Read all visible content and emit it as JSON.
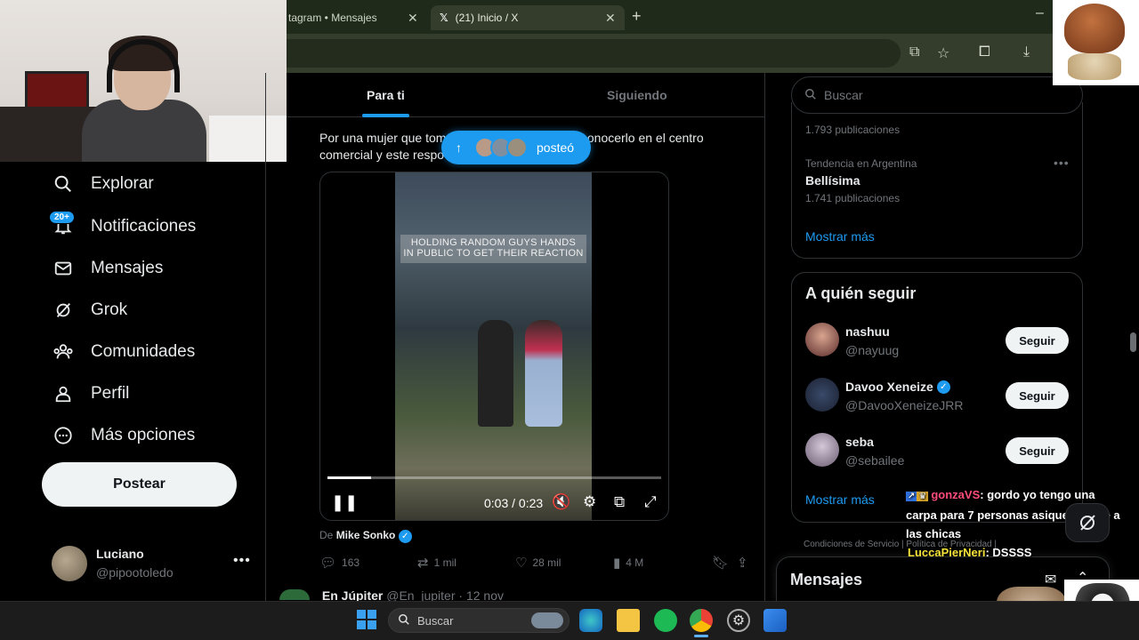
{
  "browser": {
    "tabs": [
      {
        "label": "tagram • Mensajes"
      },
      {
        "label": "(21) Inicio / X"
      }
    ],
    "new_tab": "+",
    "minimize": "–"
  },
  "nav": {
    "items": [
      {
        "label": "Explorar",
        "icon": "search-icon"
      },
      {
        "label": "Notificaciones",
        "icon": "bell-icon",
        "badge": "20+"
      },
      {
        "label": "Mensajes",
        "icon": "mail-icon"
      },
      {
        "label": "Grok",
        "icon": "grok-icon"
      },
      {
        "label": "Comunidades",
        "icon": "communities-icon"
      },
      {
        "label": "Perfil",
        "icon": "person-icon"
      },
      {
        "label": "Más opciones",
        "icon": "more-circle-icon"
      }
    ],
    "post_button": "Postear",
    "account": {
      "name": "Luciano",
      "handle": "@pipootoledo",
      "more": "•••"
    }
  },
  "timeline": {
    "tabs": [
      {
        "label": "Para ti",
        "active": true
      },
      {
        "label": "Siguiendo",
        "active": false
      }
    ],
    "new_posts_pill": {
      "label": "posteó"
    },
    "post": {
      "text_before": "Por una mujer que tom",
      "text_after": "o sin conocerlo en el centro",
      "text_line2": "comercial y este respo",
      "video": {
        "caption_line1": "HOLDING RANDOM GUYS HANDS",
        "caption_line2": "IN PUBLIC TO GET THEIR REACTION",
        "time": "0:03 / 0:23",
        "progress": 0.13
      },
      "source_prefix": "De",
      "source_name": "Mike Sonko",
      "actions": {
        "replies": "163",
        "reposts": "1 mil",
        "likes": "28 mil",
        "views": "4 M"
      }
    },
    "next_post": {
      "name": "En Júpiter",
      "handle": "@En_jupiter",
      "date": "· 12 nov"
    }
  },
  "sidebar": {
    "search_placeholder": "Buscar",
    "trends": [
      {
        "count": "1.793 publicaciones"
      },
      {
        "context": "Tendencia en Argentina",
        "name": "Bellísima",
        "count": "1.741 publicaciones"
      }
    ],
    "trends_more": "•••",
    "trends_show_more": "Mostrar más",
    "who_to_follow": {
      "title": "A quién seguir",
      "users": [
        {
          "name": "nashuu",
          "handle": "@nayuug",
          "verified": false,
          "button": "Seguir"
        },
        {
          "name": "Davoo Xeneize",
          "handle": "@DavooXeneizeJRR",
          "verified": true,
          "button": "Seguir"
        },
        {
          "name": "seba",
          "handle": "@sebailee",
          "verified": false,
          "button": "Seguir"
        }
      ],
      "show_more": "Mostrar más"
    },
    "footer": "Condiciones de Servicio   |   Política de Privacidad   |",
    "messages_drawer": "Mensajes"
  },
  "stream_chat": [
    {
      "user": "gonzaVS",
      "message": ": gordo yo tengo una carpa para 7 personas asique avisale a las chicas"
    },
    {
      "user": "LuccaPierNeri",
      "message": ": DSSSS"
    }
  ],
  "taskbar": {
    "search_placeholder": "Buscar",
    "apps": [
      "explorer-icon",
      "edge-icon",
      "files-icon",
      "spotify-icon",
      "chrome-icon",
      "settings-icon",
      "paint-icon"
    ]
  },
  "colors": {
    "accent": "#1d9bf0",
    "background": "#000000",
    "text": "#e7e9ea",
    "muted": "#71767b"
  }
}
